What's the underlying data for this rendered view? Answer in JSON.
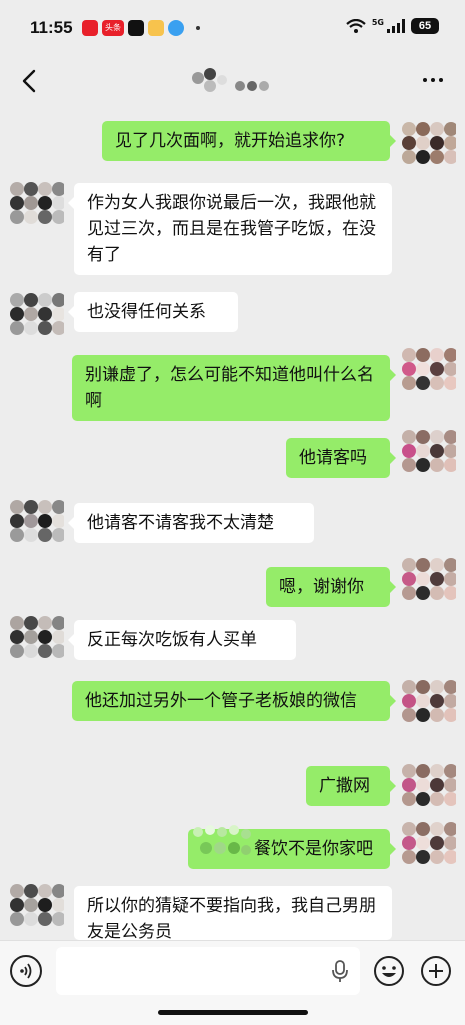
{
  "status_bar": {
    "time": "11:55",
    "news_badge": "头条",
    "network": "5G",
    "battery": "65"
  },
  "messages": [
    {
      "side": "right",
      "text": "见了几次面啊，就开始追求你?"
    },
    {
      "side": "left",
      "text": "作为女人我跟你说最后一次，我跟他就见过三次，而且是在我管子吃饭，在没有了"
    },
    {
      "side": "left",
      "text": "也没得任何关系"
    },
    {
      "side": "right",
      "text": "别谦虚了，怎么可能不知道他叫什么名啊"
    },
    {
      "side": "right",
      "text": "他请客吗"
    },
    {
      "side": "left",
      "text": "他请客不请客我不太清楚"
    },
    {
      "side": "right",
      "text": "嗯，谢谢你"
    },
    {
      "side": "left",
      "text": "反正每次吃饭有人买单"
    },
    {
      "side": "right",
      "text": "他还加过另外一个管子老板娘的微信"
    },
    {
      "side": "right",
      "text": "广撒网"
    },
    {
      "side": "right",
      "text": "餐饮不是你家吧"
    },
    {
      "side": "left",
      "text": "所以你的猜疑不要指向我，我自己男朋友是公务员"
    }
  ],
  "colors": {
    "background": "#ededed",
    "bubble_self": "#95ec69",
    "bubble_other": "#ffffff"
  },
  "input_bar": {
    "placeholder": "",
    "icons": [
      "voice-icon",
      "mic-icon",
      "emoji-icon",
      "plus-icon"
    ]
  }
}
